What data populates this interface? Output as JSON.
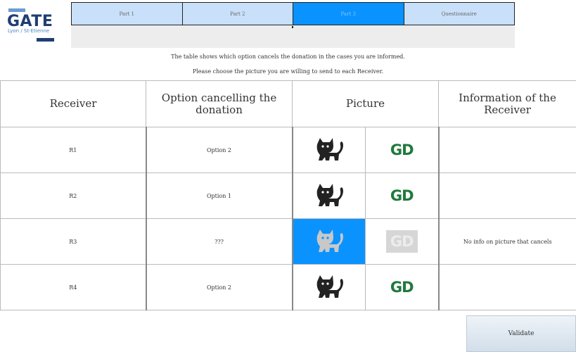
{
  "logo": {
    "name": "GATE",
    "subtitle": "Lyon / St-Etienne"
  },
  "tabs": [
    {
      "label": "Part 1",
      "active": false
    },
    {
      "label": "Part 2",
      "active": false
    },
    {
      "label": "Part 3",
      "active": true
    },
    {
      "label": "Questionnaire",
      "active": false
    }
  ],
  "instructions": {
    "line1": "The table shows which option cancels the donation in the cases you are informed.",
    "line2": "Please choose the picture you are willing to send to each Receiver."
  },
  "table": {
    "headers": {
      "receiver": "Receiver",
      "option": "Option cancelling the donation",
      "picture": "Picture",
      "info": "Information of the Receiver"
    },
    "rows": [
      {
        "receiver": "R1",
        "option": "Option 2",
        "info": "",
        "selected_picture": "none",
        "gd_enabled": true
      },
      {
        "receiver": "R2",
        "option": "Option 1",
        "info": "",
        "selected_picture": "none",
        "gd_enabled": true
      },
      {
        "receiver": "R3",
        "option": "???",
        "info": "No info on picture that cancels",
        "selected_picture": "cat",
        "gd_enabled": false
      },
      {
        "receiver": "R4",
        "option": "Option 2",
        "info": "",
        "selected_picture": "none",
        "gd_enabled": true
      }
    ],
    "picture_labels": {
      "gd": "GD"
    },
    "icons": {
      "animal": "cat-icon",
      "letters": "gd-logo-icon"
    }
  },
  "validate_label": "Validate",
  "colors": {
    "tab_active": "#0a93ff",
    "tab_inactive": "#c9e0fa",
    "selected_cell": "#0a93ff",
    "gd_green": "#1f7a3c",
    "logo_navy": "#1f3e73"
  }
}
